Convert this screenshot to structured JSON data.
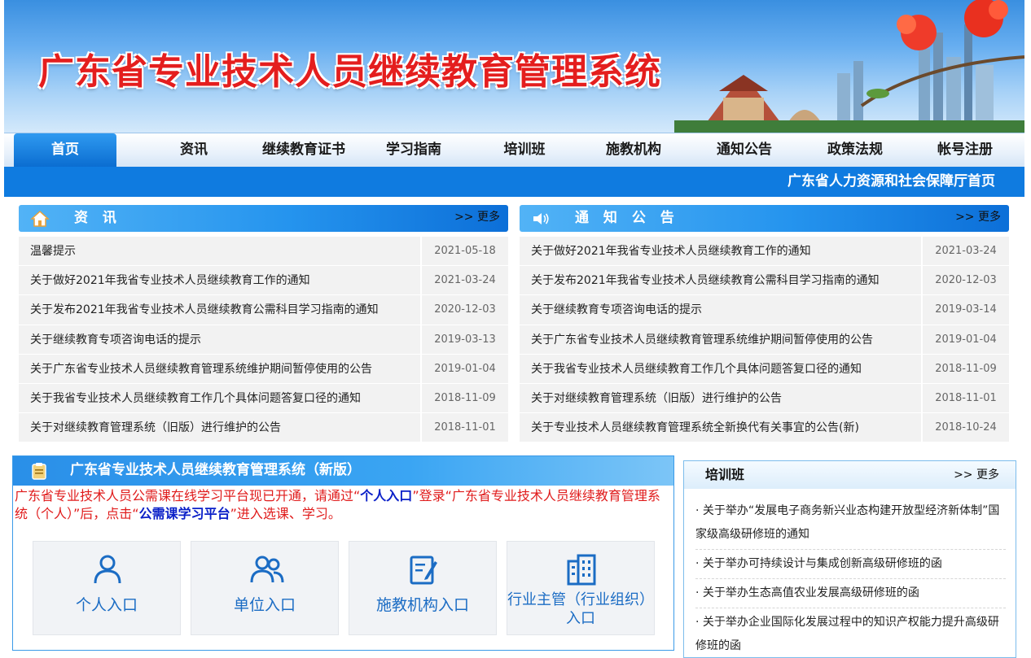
{
  "header": {
    "title": "广东省专业技术人员继续教育管理系统"
  },
  "nav": {
    "items": [
      "首页",
      "资讯",
      "继续教育证书",
      "学习指南",
      "培训班",
      "施教机构",
      "通知公告",
      "政策法规",
      "帐号注册"
    ],
    "sub_link": "广东省人力资源和社会保障厅首页"
  },
  "news": {
    "title": "资 讯",
    "more": ">> 更多",
    "rows": [
      {
        "title": "温馨提示",
        "date": "2021-05-18"
      },
      {
        "title": "关于做好2021年我省专业技术人员继续教育工作的通知",
        "date": "2021-03-24"
      },
      {
        "title": "关于发布2021年我省专业技术人员继续教育公需科目学习指南的通知",
        "date": "2020-12-03"
      },
      {
        "title": "关于继续教育专项咨询电话的提示",
        "date": "2019-03-13"
      },
      {
        "title": "关于广东省专业技术人员继续教育管理系统维护期间暂停使用的公告",
        "date": "2019-01-04"
      },
      {
        "title": "关于我省专业技术人员继续教育工作几个具体问题答复口径的通知",
        "date": "2018-11-09"
      },
      {
        "title": "关于对继续教育管理系统（旧版）进行维护的公告",
        "date": "2018-11-01"
      }
    ]
  },
  "notice": {
    "title": "通 知 公 告",
    "more": ">> 更多",
    "rows": [
      {
        "title": "关于做好2021年我省专业技术人员继续教育工作的通知",
        "date": "2021-03-24"
      },
      {
        "title": "关于发布2021年我省专业技术人员继续教育公需科目学习指南的通知",
        "date": "2020-12-03"
      },
      {
        "title": "关于继续教育专项咨询电话的提示",
        "date": "2019-03-14"
      },
      {
        "title": "关于广东省专业技术人员继续教育管理系统维护期间暂停使用的公告",
        "date": "2019-01-04"
      },
      {
        "title": "关于我省专业技术人员继续教育工作几个具体问题答复口径的通知",
        "date": "2018-11-09"
      },
      {
        "title": "关于对继续教育管理系统（旧版）进行维护的公告",
        "date": "2018-11-01"
      },
      {
        "title": "关于专业技术人员继续教育管理系统全新换代有关事宜的公告(新)",
        "date": "2018-10-24"
      }
    ]
  },
  "new_system": {
    "title": "广东省专业技术人员继续教育管理系统（新版）",
    "note_part1": "广东省专业技术人员公需课在线学习平台现已开通，请通过“",
    "note_link1": "个人入口",
    "note_part2": "”登录“广东省专业技术人员继续教育管理系统（个人）”后，点击“",
    "note_link2": "公需课学习平台",
    "note_part3": "”进入选课、学习。",
    "entries": [
      {
        "label": "个人入口",
        "icon": "person-icon"
      },
      {
        "label": "单位入口",
        "icon": "group-icon"
      },
      {
        "label": "施教机构入口",
        "icon": "edit-document-icon"
      },
      {
        "label": "行业主管（行业组织）入口",
        "icon": "building-icon"
      }
    ]
  },
  "training": {
    "title": "培训班",
    "more": ">> 更多",
    "items": [
      "· 关于举办“发展电子商务新兴业态构建开放型经济新体制”国家级高级研修班的通知",
      "· 关于举办可持续设计与集成创新高级研修班的函",
      "· 关于举办生态高值农业发展高级研修班的函",
      "· 关于举办企业国际化发展过程中的知识产权能力提升高级研修班的函"
    ]
  }
}
